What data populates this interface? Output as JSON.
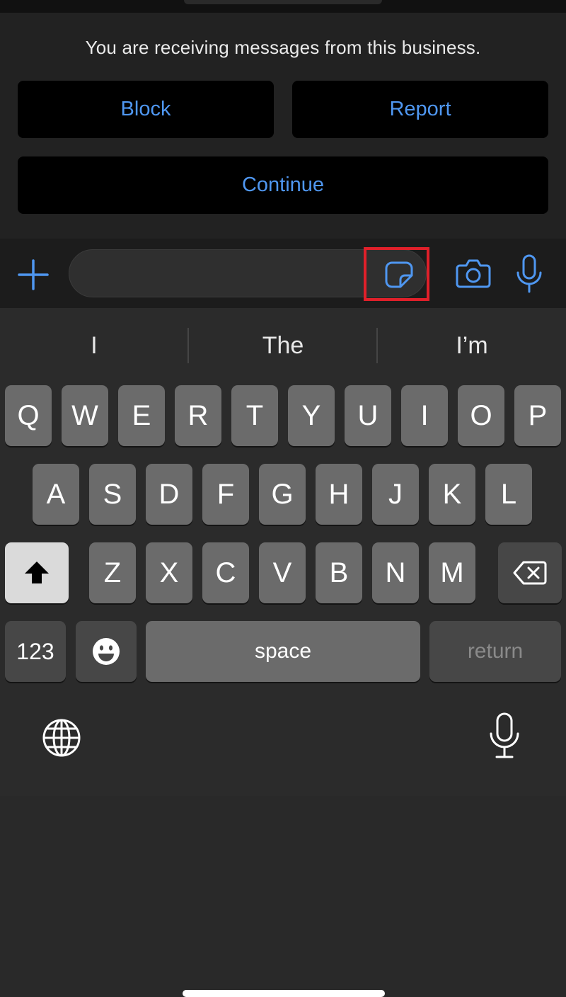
{
  "banner": {
    "notice": "You are receiving messages from this business.",
    "block_label": "Block",
    "report_label": "Report",
    "continue_label": "Continue"
  },
  "input_bar": {
    "message_value": "",
    "icons": [
      "plus-icon",
      "sticker-icon",
      "camera-icon",
      "microphone-icon"
    ]
  },
  "keyboard": {
    "suggestions": [
      "I",
      "The",
      "I’m"
    ],
    "row1": [
      "Q",
      "W",
      "E",
      "R",
      "T",
      "Y",
      "U",
      "I",
      "O",
      "P"
    ],
    "row2": [
      "A",
      "S",
      "D",
      "F",
      "G",
      "H",
      "J",
      "K",
      "L"
    ],
    "row3": [
      "Z",
      "X",
      "C",
      "V",
      "B",
      "N",
      "M"
    ],
    "numbers_label": "123",
    "space_label": "space",
    "return_label": "return",
    "icons": [
      "shift-icon",
      "backspace-icon",
      "emoji-icon",
      "globe-icon",
      "dictation-icon"
    ]
  },
  "colors": {
    "accent": "#4f97f1",
    "highlight": "#e0202a",
    "key": "#6b6b6b",
    "key_dark": "#474747"
  }
}
